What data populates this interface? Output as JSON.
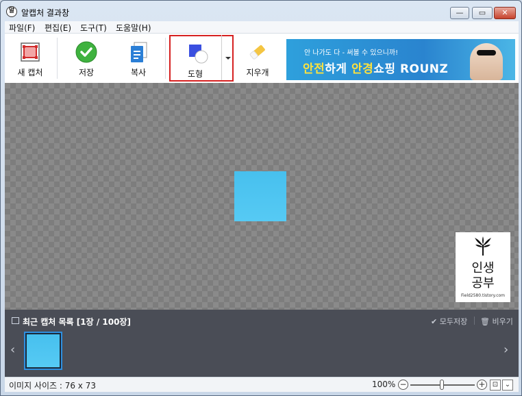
{
  "window": {
    "title": "알캡처 결과창",
    "app_icon": "알"
  },
  "titlebar": {
    "minimize": "—",
    "maximize": "▭",
    "close": "✕"
  },
  "menu": [
    "파일(F)",
    "편집(E)",
    "도구(T)",
    "도움말(H)"
  ],
  "toolbar": {
    "new_capture": "새 캡처",
    "save": "저장",
    "copy": "복사",
    "shape": "도형",
    "eraser": "지우개"
  },
  "ad": {
    "small_text": "안 나가도 다 - 써볼 수 있으니까!",
    "big_text_a": "안전",
    "big_text_b": "하게 ",
    "big_text_c": "안경",
    "big_text_d": "쇼핑 ROUNZ"
  },
  "watermark": {
    "line1": "인생",
    "line2": "공부",
    "url": "Field2580.tistory.com"
  },
  "recent": {
    "title": "최근 캡처 목록 [1장 / 100장]",
    "save_all": "✔ 모두저장",
    "clear_all": "🗑 비우기",
    "prev": "‹",
    "next": "›"
  },
  "status": {
    "image_size": "이미지 사이즈 : 76 x 73",
    "zoom": "100%",
    "zoom_minus": "−",
    "zoom_plus": "+",
    "fit": "⊡",
    "more": "⌄"
  },
  "colors": {
    "accent": "#2e8fe0",
    "highlight": "#d62020",
    "capture_fill": "#4fc4f0"
  }
}
